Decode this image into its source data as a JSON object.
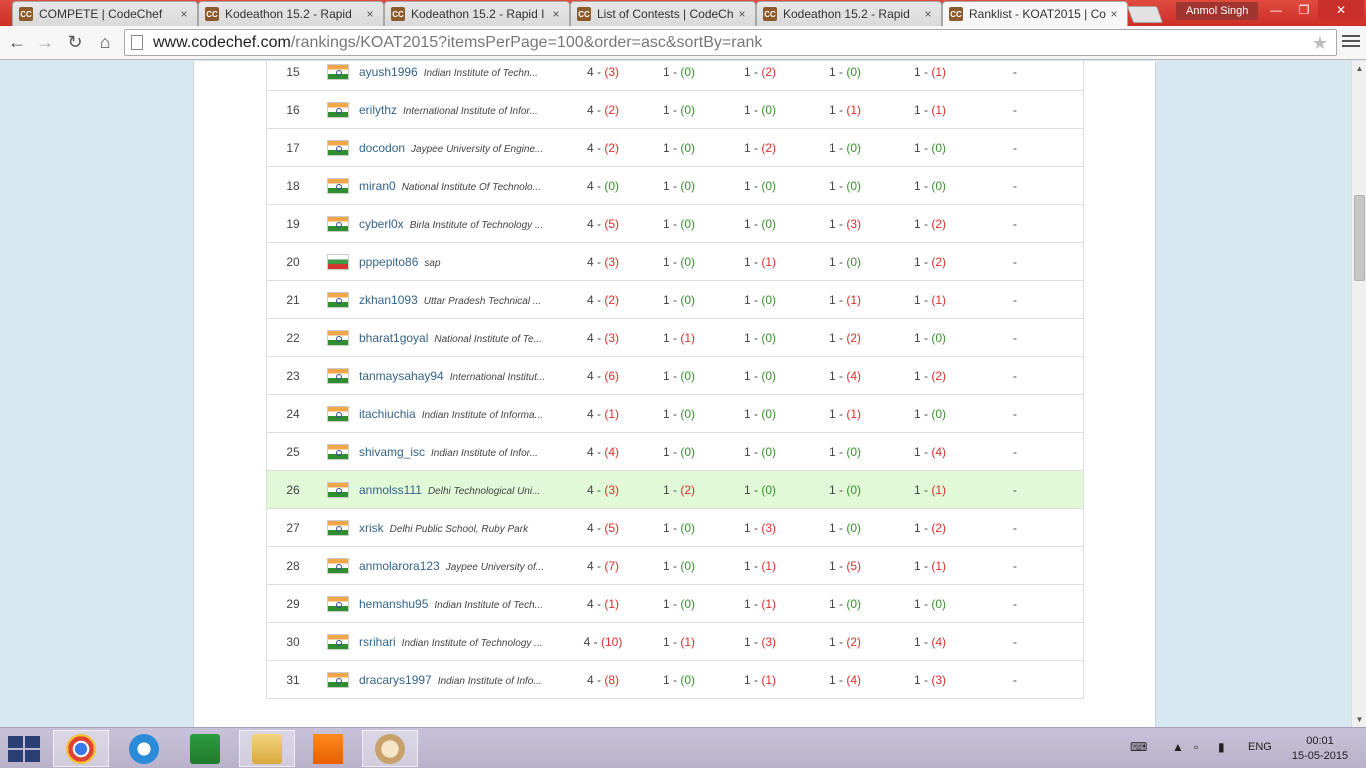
{
  "browser": {
    "tabs": [
      {
        "favicon": "CC",
        "title": "COMPETE | CodeChef",
        "active": false
      },
      {
        "favicon": "CC",
        "title": "Kodeathon 15.2 - Rapid",
        "active": false
      },
      {
        "favicon": "CC",
        "title": "Kodeathon 15.2 - Rapid I",
        "active": false
      },
      {
        "favicon": "CC",
        "title": "List of Contests | CodeCh",
        "active": false
      },
      {
        "favicon": "CC",
        "title": "Kodeathon 15.2 - Rapid",
        "active": false
      },
      {
        "favicon": "CC",
        "title": "Ranklist - KOAT2015 | Co",
        "active": true
      }
    ],
    "profile_name": "Anmol Singh",
    "url_host": "www.codechef.com",
    "url_path": "/rankings/KOAT2015?itemsPerPage=100&order=asc&sortBy=rank",
    "close_glyph": "×"
  },
  "ranklist": {
    "rows": [
      {
        "rank": "15",
        "flag": "in",
        "handle": "ayush1996",
        "inst": "Indian Institute of Techn...",
        "scores": [
          [
            "4 - ",
            "(3)",
            "red"
          ],
          [
            "1 - ",
            "(0)",
            "green"
          ],
          [
            "1 - ",
            "(2)",
            "red"
          ],
          [
            "1 - ",
            "(0)",
            "green"
          ],
          [
            "1 - ",
            "(1)",
            "red"
          ]
        ],
        "last": "-"
      },
      {
        "rank": "16",
        "flag": "in",
        "handle": "erilythz",
        "inst": "International Institute of Infor...",
        "scores": [
          [
            "4 - ",
            "(2)",
            "red"
          ],
          [
            "1 - ",
            "(0)",
            "green"
          ],
          [
            "1 - ",
            "(0)",
            "green"
          ],
          [
            "1 - ",
            "(1)",
            "red"
          ],
          [
            "1 - ",
            "(1)",
            "red"
          ]
        ],
        "last": "-"
      },
      {
        "rank": "17",
        "flag": "in",
        "handle": "docodon",
        "inst": "Jaypee University of Engine...",
        "scores": [
          [
            "4 - ",
            "(2)",
            "red"
          ],
          [
            "1 - ",
            "(0)",
            "green"
          ],
          [
            "1 - ",
            "(2)",
            "red"
          ],
          [
            "1 - ",
            "(0)",
            "green"
          ],
          [
            "1 - ",
            "(0)",
            "green"
          ]
        ],
        "last": "-"
      },
      {
        "rank": "18",
        "flag": "in",
        "handle": "miran0",
        "inst": "National Institute Of Technolo...",
        "scores": [
          [
            "4 - ",
            "(0)",
            "green"
          ],
          [
            "1 - ",
            "(0)",
            "green"
          ],
          [
            "1 - ",
            "(0)",
            "green"
          ],
          [
            "1 - ",
            "(0)",
            "green"
          ],
          [
            "1 - ",
            "(0)",
            "green"
          ]
        ],
        "last": "-"
      },
      {
        "rank": "19",
        "flag": "in",
        "handle": "cyberl0x",
        "inst": "Birla Institute of Technology ...",
        "scores": [
          [
            "4 - ",
            "(5)",
            "red"
          ],
          [
            "1 - ",
            "(0)",
            "green"
          ],
          [
            "1 - ",
            "(0)",
            "green"
          ],
          [
            "1 - ",
            "(3)",
            "red"
          ],
          [
            "1 - ",
            "(2)",
            "red"
          ]
        ],
        "last": "-"
      },
      {
        "rank": "20",
        "flag": "bg",
        "handle": "pppepito86",
        "inst": "sap",
        "scores": [
          [
            "4 - ",
            "(3)",
            "red"
          ],
          [
            "1 - ",
            "(0)",
            "green"
          ],
          [
            "1 - ",
            "(1)",
            "red"
          ],
          [
            "1 - ",
            "(0)",
            "green"
          ],
          [
            "1 - ",
            "(2)",
            "red"
          ]
        ],
        "last": "-"
      },
      {
        "rank": "21",
        "flag": "in",
        "handle": "zkhan1093",
        "inst": "Uttar Pradesh Technical ...",
        "scores": [
          [
            "4 - ",
            "(2)",
            "red"
          ],
          [
            "1 - ",
            "(0)",
            "green"
          ],
          [
            "1 - ",
            "(0)",
            "green"
          ],
          [
            "1 - ",
            "(1)",
            "red"
          ],
          [
            "1 - ",
            "(1)",
            "red"
          ]
        ],
        "last": "-"
      },
      {
        "rank": "22",
        "flag": "in",
        "handle": "bharat1goyal",
        "inst": "National Institute of Te...",
        "scores": [
          [
            "4 - ",
            "(3)",
            "red"
          ],
          [
            "1 - ",
            "(1)",
            "red"
          ],
          [
            "1 - ",
            "(0)",
            "green"
          ],
          [
            "1 - ",
            "(2)",
            "red"
          ],
          [
            "1 - ",
            "(0)",
            "green"
          ]
        ],
        "last": "-"
      },
      {
        "rank": "23",
        "flag": "in",
        "handle": "tanmaysahay94",
        "inst": "International Institut...",
        "scores": [
          [
            "4 - ",
            "(6)",
            "red"
          ],
          [
            "1 - ",
            "(0)",
            "green"
          ],
          [
            "1 - ",
            "(0)",
            "green"
          ],
          [
            "1 - ",
            "(4)",
            "red"
          ],
          [
            "1 - ",
            "(2)",
            "red"
          ]
        ],
        "last": "-"
      },
      {
        "rank": "24",
        "flag": "in",
        "handle": "itachiuchia",
        "inst": "Indian Institute of Informa...",
        "scores": [
          [
            "4 - ",
            "(1)",
            "red"
          ],
          [
            "1 - ",
            "(0)",
            "green"
          ],
          [
            "1 - ",
            "(0)",
            "green"
          ],
          [
            "1 - ",
            "(1)",
            "red"
          ],
          [
            "1 - ",
            "(0)",
            "green"
          ]
        ],
        "last": "-"
      },
      {
        "rank": "25",
        "flag": "in",
        "handle": "shivamg_isc",
        "inst": "Indian Institute of Infor...",
        "scores": [
          [
            "4 - ",
            "(4)",
            "red"
          ],
          [
            "1 - ",
            "(0)",
            "green"
          ],
          [
            "1 - ",
            "(0)",
            "green"
          ],
          [
            "1 - ",
            "(0)",
            "green"
          ],
          [
            "1 - ",
            "(4)",
            "red"
          ]
        ],
        "last": "-"
      },
      {
        "rank": "26",
        "flag": "in",
        "handle": "anmolss111",
        "inst": "Delhi Technological Uni...",
        "scores": [
          [
            "4 - ",
            "(3)",
            "red"
          ],
          [
            "1 - ",
            "(2)",
            "red"
          ],
          [
            "1 - ",
            "(0)",
            "green"
          ],
          [
            "1 - ",
            "(0)",
            "green"
          ],
          [
            "1 - ",
            "(1)",
            "red"
          ]
        ],
        "last": "-",
        "highlight": true
      },
      {
        "rank": "27",
        "flag": "in",
        "handle": "xrisk",
        "inst": "Delhi Public School, Ruby Park",
        "scores": [
          [
            "4 - ",
            "(5)",
            "red"
          ],
          [
            "1 - ",
            "(0)",
            "green"
          ],
          [
            "1 - ",
            "(3)",
            "red"
          ],
          [
            "1 - ",
            "(0)",
            "green"
          ],
          [
            "1 - ",
            "(2)",
            "red"
          ]
        ],
        "last": "-"
      },
      {
        "rank": "28",
        "flag": "in",
        "handle": "anmolarora123",
        "inst": "Jaypee University of...",
        "scores": [
          [
            "4 - ",
            "(7)",
            "red"
          ],
          [
            "1 - ",
            "(0)",
            "green"
          ],
          [
            "1 - ",
            "(1)",
            "red"
          ],
          [
            "1 - ",
            "(5)",
            "red"
          ],
          [
            "1 - ",
            "(1)",
            "red"
          ]
        ],
        "last": "-"
      },
      {
        "rank": "29",
        "flag": "in",
        "handle": "hemanshu95",
        "inst": "Indian Institute of Tech...",
        "scores": [
          [
            "4 - ",
            "(1)",
            "red"
          ],
          [
            "1 - ",
            "(0)",
            "green"
          ],
          [
            "1 - ",
            "(1)",
            "red"
          ],
          [
            "1 - ",
            "(0)",
            "green"
          ],
          [
            "1 - ",
            "(0)",
            "green"
          ]
        ],
        "last": "-"
      },
      {
        "rank": "30",
        "flag": "in",
        "handle": "rsrihari",
        "inst": "Indian Institute of Technology ...",
        "scores": [
          [
            "4 - ",
            "(10)",
            "red"
          ],
          [
            "1 - ",
            "(1)",
            "red"
          ],
          [
            "1 - ",
            "(3)",
            "red"
          ],
          [
            "1 - ",
            "(2)",
            "red"
          ],
          [
            "1 - ",
            "(4)",
            "red"
          ]
        ],
        "last": "-"
      },
      {
        "rank": "31",
        "flag": "in",
        "handle": "dracarys1997",
        "inst": "Indian Institute of Info...",
        "scores": [
          [
            "4 - ",
            "(8)",
            "red"
          ],
          [
            "1 - ",
            "(0)",
            "green"
          ],
          [
            "1 - ",
            "(1)",
            "red"
          ],
          [
            "1 - ",
            "(4)",
            "red"
          ],
          [
            "1 - ",
            "(3)",
            "red"
          ]
        ],
        "last": "-"
      }
    ]
  },
  "taskbar": {
    "apps": [
      "chrome-icon",
      "internet-explorer-icon",
      "store-icon",
      "file-explorer-icon",
      "vlc-icon",
      "paint-icon"
    ],
    "language": "ENG",
    "time": "00:01",
    "date": "15-05-2015"
  },
  "colors": {
    "penalty_red": "#d9302b",
    "penalty_green": "#3a8f2f",
    "handle_blue": "#35648a",
    "highlight_row": "#e2f9d8"
  }
}
